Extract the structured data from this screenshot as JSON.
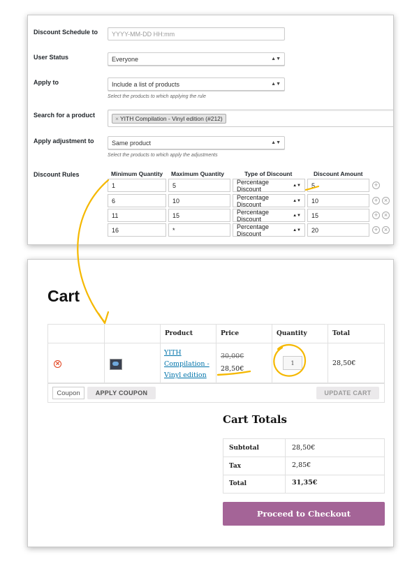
{
  "rule_form": {
    "schedule_label": "Discount Schedule to",
    "schedule_placeholder": "YYYY-MM-DD HH:mm",
    "user_status_label": "User Status",
    "user_status_value": "Everyone",
    "apply_to_label": "Apply to",
    "apply_to_value": "Include a list of products",
    "apply_to_desc": "Select the products to which applying the rule",
    "search_label": "Search for a product",
    "search_token": "YITH Compilation - Vinyl edition (#212)",
    "search_token_remove": "×",
    "adjust_label": "Apply adjustment to",
    "adjust_value": "Same product",
    "adjust_desc": "Select the products to which apply the adjustments",
    "rules_label": "Discount Rules",
    "rules_headers": [
      "Minimum Quantity",
      "Maximum Quantity",
      "Type of Discount",
      "Discount Amount"
    ],
    "rules_rows": [
      {
        "min": "1",
        "max": "5",
        "type": "Percentage Discount",
        "amount": "5"
      },
      {
        "min": "6",
        "max": "10",
        "type": "Percentage Discount",
        "amount": "10"
      },
      {
        "min": "11",
        "max": "15",
        "type": "Percentage Discount",
        "amount": "15"
      },
      {
        "min": "16",
        "max": "*",
        "type": "Percentage Discount",
        "amount": "20"
      }
    ],
    "add_symbol": "+",
    "remove_symbol": "×",
    "select_arrow": "▲▼"
  },
  "cart": {
    "title": "Cart",
    "headers": {
      "product": "Product",
      "price": "Price",
      "quantity": "Quantity",
      "total": "Total"
    },
    "item": {
      "remove": "×",
      "name_line1": "YITH",
      "name_line2": "Compilation -",
      "name_line3": "Vinyl edition",
      "old_price": "30,00€",
      "new_price": "28,50€",
      "quantity": "1",
      "total": "28,50€"
    },
    "coupon_placeholder": "Coupon",
    "apply_coupon": "APPLY COUPON",
    "update_cart": "UPDATE CART"
  },
  "totals": {
    "title": "Cart Totals",
    "rows": [
      {
        "label": "Subtotal",
        "value": "28,50€"
      },
      {
        "label": "Tax",
        "value": "2,85€"
      },
      {
        "label": "Total",
        "value": "31,35€"
      }
    ],
    "checkout": "Proceed to Checkout"
  },
  "colors": {
    "annotation": "#f5b800",
    "checkout": "#a46497",
    "remove": "#e2401c",
    "link": "#0073aa"
  }
}
